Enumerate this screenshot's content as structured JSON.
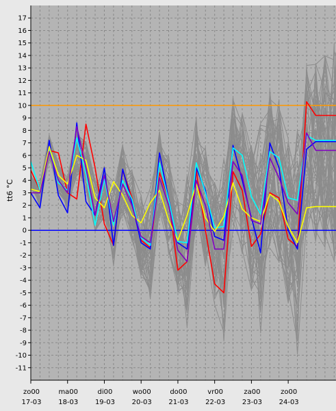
{
  "chart_data": {
    "type": "line",
    "title": "",
    "ylabel": "tt6 °C",
    "xlabel": "",
    "ylim": [
      -12,
      18
    ],
    "yticks": [
      -11,
      -10,
      -9,
      -8,
      -7,
      -6,
      -5,
      -4,
      -3,
      -2,
      -1,
      0,
      1,
      2,
      3,
      4,
      5,
      6,
      7,
      8,
      9,
      10,
      11,
      12,
      13,
      14,
      15,
      16,
      17
    ],
    "x_range": [
      0,
      8.3
    ],
    "x_ticks": [
      {
        "x": 0,
        "line1": "zo00",
        "line2": "17-03"
      },
      {
        "x": 1,
        "line1": "ma00",
        "line2": "18-03"
      },
      {
        "x": 2,
        "line1": "di00",
        "line2": "19-03"
      },
      {
        "x": 3,
        "line1": "wo00",
        "line2": "20-03"
      },
      {
        "x": 4,
        "line1": "do00",
        "line2": "21-03"
      },
      {
        "x": 5,
        "line1": "vr00",
        "line2": "22-03"
      },
      {
        "x": 6,
        "line1": "za00",
        "line2": "23-03"
      },
      {
        "x": 7,
        "line1": "zo00",
        "line2": "24-03"
      }
    ],
    "grid": true,
    "background": "#b4b4b4",
    "reference_lines": [
      {
        "y": 10,
        "color": "#ff9900"
      },
      {
        "y": 0,
        "color": "#0000ff"
      }
    ],
    "ensemble_color": "#8c8c8c",
    "ensemble_count": 50,
    "series": [
      {
        "color": "#ff0000",
        "x": [
          0,
          0.25,
          0.5,
          0.75,
          1,
          1.25,
          1.5,
          1.75,
          2,
          2.25,
          2.5,
          2.75,
          3,
          3.25,
          3.5,
          3.75,
          4,
          4.25,
          4.5,
          4.75,
          5,
          5.25,
          5.5,
          5.75,
          6,
          6.25,
          6.5,
          6.75,
          7,
          7.25,
          7.5,
          7.75,
          8,
          8.25,
          8.3
        ],
        "y": [
          4.8,
          3.2,
          6.4,
          6.2,
          3,
          2.5,
          8.5,
          5,
          0.5,
          -1.2,
          4.8,
          2.6,
          -0.8,
          -1.4,
          4.6,
          2.5,
          -3.2,
          -2.5,
          4.8,
          0,
          -4.3,
          -5,
          4.7,
          3.2,
          -1.3,
          -0.3,
          3,
          2.6,
          -0.7,
          -1.3,
          10.3,
          9.2,
          9.2,
          9.2,
          9.2
        ]
      },
      {
        "color": "#0000ff",
        "x": [
          0,
          0.25,
          0.5,
          0.75,
          1,
          1.25,
          1.5,
          1.75,
          2,
          2.25,
          2.5,
          2.75,
          3,
          3.25,
          3.5,
          3.75,
          4,
          4.25,
          4.5,
          4.75,
          5,
          5.25,
          5.5,
          5.75,
          6,
          6.25,
          6.5,
          6.75,
          7,
          7.25,
          7.5,
          7.75,
          8,
          8.25,
          8.3
        ],
        "y": [
          3,
          1.8,
          7.2,
          2.8,
          1.4,
          8.6,
          2.3,
          1.2,
          5,
          -1.2,
          4.9,
          2.2,
          -1,
          -1.5,
          6.2,
          2.5,
          -1,
          -1.5,
          5,
          3.2,
          -0.5,
          -0.8,
          6.8,
          4,
          1,
          -1.8,
          7,
          5,
          0,
          -1.5,
          6.5,
          7.1,
          7.1,
          7.1,
          7.1
        ]
      },
      {
        "color": "#00ffff",
        "x": [
          0,
          0.25,
          0.5,
          0.75,
          1,
          1.25,
          1.5,
          1.75,
          2,
          2.25,
          2.5,
          2.75,
          3,
          3.25,
          3.5,
          3.75,
          4,
          4.25,
          4.5,
          4.75,
          5,
          5.25,
          5.5,
          5.75,
          6,
          6.25,
          6.5,
          6.75,
          7,
          7.25,
          7.5,
          7.75,
          8,
          8.25,
          8.3
        ],
        "y": [
          5.5,
          3.2,
          6.6,
          3.8,
          3.2,
          7.4,
          4.5,
          0.4,
          4.1,
          0.4,
          4,
          2.5,
          -0.6,
          -1.2,
          5.4,
          2.4,
          -0.9,
          -1,
          5.4,
          3,
          0.2,
          0.3,
          6.6,
          6,
          2.7,
          1.3,
          6.3,
          5.8,
          2.6,
          2.4,
          7.6,
          7.2,
          7.2,
          7.2,
          7.2
        ]
      },
      {
        "color": "#ffff00",
        "x": [
          0,
          0.25,
          0.5,
          0.75,
          1,
          1.25,
          1.5,
          1.75,
          2,
          2.25,
          2.5,
          2.75,
          3,
          3.25,
          3.5,
          3.75,
          4,
          4.25,
          4.5,
          4.75,
          5,
          5.25,
          5.5,
          5.75,
          6,
          6.25,
          6.5,
          6.75,
          7,
          7.25,
          7.5,
          7.75,
          8,
          8.25,
          8.3
        ],
        "y": [
          3.3,
          3.1,
          6.7,
          4.4,
          3.7,
          6,
          5.6,
          2.6,
          1.8,
          3.9,
          2.8,
          1.2,
          0.6,
          2.2,
          3.2,
          0.8,
          -0.8,
          1.2,
          3.7,
          1,
          -0.1,
          1.1,
          3.8,
          1.7,
          1,
          0.7,
          2.9,
          2.3,
          0.3,
          -1,
          1.8,
          1.9,
          1.9,
          1.9,
          1.9
        ]
      },
      {
        "color": "#8000c0",
        "x": [
          0,
          0.25,
          0.5,
          0.75,
          1,
          1.25,
          1.5,
          1.75,
          2,
          2.25,
          2.5,
          2.75,
          3,
          3.25,
          3.5,
          3.75,
          4,
          4.25,
          4.5,
          4.75,
          5,
          5.25,
          5.5,
          5.75,
          6,
          6.25,
          6.5,
          6.75,
          7,
          7.25,
          7.5,
          7.75,
          8,
          8.25,
          8.3
        ],
        "y": [
          3,
          3,
          6.3,
          4,
          3,
          8.3,
          5,
          1.2,
          4.4,
          0.7,
          3.7,
          2,
          -0.5,
          -1,
          4.2,
          2,
          -1.6,
          -2.5,
          4,
          2,
          -1.5,
          -1.5,
          5.5,
          4.4,
          0.8,
          0.5,
          5.8,
          4.2,
          2.2,
          1.3,
          7.8,
          6.4,
          6.4,
          6.4,
          6.4
        ]
      }
    ]
  }
}
